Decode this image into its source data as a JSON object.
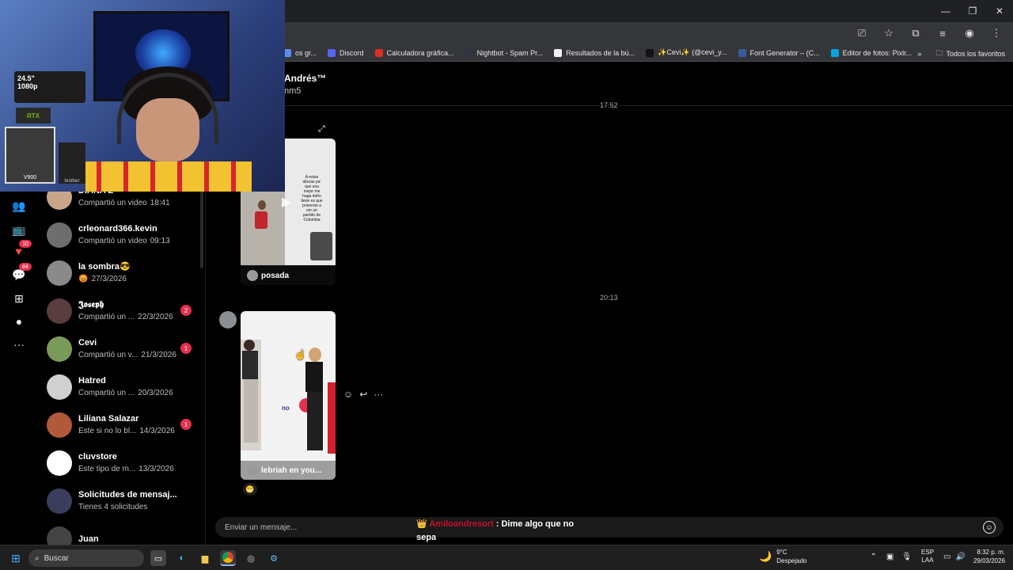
{
  "browser": {
    "controls": {
      "minimize": "—",
      "maximize": "❐",
      "close": "✕"
    },
    "address_icons": [
      "cast-icon",
      "star-icon",
      "extensions-icon",
      "media-icon",
      "profile-icon",
      "menu-icon"
    ],
    "bookmarks": [
      {
        "label": "os gr...",
        "color": "#5b8def"
      },
      {
        "label": "Discord",
        "color": "#5865f2"
      },
      {
        "label": "Calculadora gráfica...",
        "color": "#d93025"
      },
      {
        "label": "Nightbot - Spam Pr...",
        "color": "#2f3542"
      },
      {
        "label": "Resultados de la bú...",
        "color": "#f1f1f1"
      },
      {
        "label": "✨Cevi✨ (@cevi_y...",
        "color": "#111111"
      },
      {
        "label": "Font Generator – (C...",
        "color": "#3b5998"
      },
      {
        "label": "Editor de fotos: Pixlr...",
        "color": "#00a6e0"
      }
    ],
    "more_bookmarks": "»",
    "all_favorites": "Todos los favoritos"
  },
  "nav": {
    "icons": [
      {
        "name": "friends-icon",
        "glyph": "👥"
      },
      {
        "name": "live-icon",
        "glyph": "📺"
      },
      {
        "name": "activity-icon",
        "glyph": "🔻",
        "badge": "10"
      },
      {
        "name": "messages-icon",
        "glyph": "💬",
        "badge": "84"
      },
      {
        "name": "upload-icon",
        "glyph": "⊞"
      },
      {
        "name": "profile-avatar-icon",
        "glyph": "●"
      },
      {
        "name": "more-icon",
        "glyph": "···"
      }
    ]
  },
  "conversations": [
    {
      "name": "DIANA Z",
      "preview": "Compartió un video",
      "time": "18:41",
      "badge": "",
      "color": "#c9a58a"
    },
    {
      "name": "crleonard366.kevin",
      "preview": "Compartió un video",
      "time": "09:13",
      "badge": "",
      "color": "#6e6e6e"
    },
    {
      "name": "la sombra😎",
      "preview": "😡",
      "time": "27/3/2026",
      "badge": "",
      "color": "#8a8a8a"
    },
    {
      "name": "𝕵𝖔𝖘𝖊𝖕𝖍",
      "preview": "Compartió un ...",
      "time": "22/3/2026",
      "badge": "2",
      "color": "#5a3d3d"
    },
    {
      "name": "Cevi",
      "preview": "Compartió un v...",
      "time": "21/3/2026",
      "badge": "1",
      "color": "#7a9a5a"
    },
    {
      "name": "Hatred",
      "preview": "Compartió un ...",
      "time": "20/3/2026",
      "badge": "",
      "color": "#d0d0d0"
    },
    {
      "name": "Liliana Salazar",
      "preview": "Este si no lo bl...",
      "time": "14/3/2026",
      "badge": "1",
      "color": "#b05a3a"
    },
    {
      "name": "cluvstore",
      "preview": "Este tipo de m...",
      "time": "13/3/2026",
      "badge": "",
      "color": "#ffffff"
    },
    {
      "name": "Solicitudes de mensaj...",
      "preview": "Tienes 4 solicitudes",
      "time": "",
      "badge": "",
      "color": "#3a3d5c"
    },
    {
      "name": "Juan",
      "preview": "",
      "time": "",
      "badge": "",
      "color": "#444444"
    }
  ],
  "chat": {
    "name": "Andrés™",
    "username": "nm5",
    "timestamp_top": "17:52",
    "timestamp_mid": "20:13",
    "video1_caption_lines": [
      "A estas",
      "alturas pa'",
      "que una",
      "mejor me",
      "haga daño",
      "tiene es que",
      "ponerme a",
      "ver un",
      "partido de",
      "Colombia"
    ],
    "video1_author": "posada",
    "video2_label": "no",
    "video2_author": "lebriah en you...",
    "reaction": "😬",
    "actions": {
      "react": "☺",
      "reply": "↩",
      "more": "···"
    },
    "expand": "⤢"
  },
  "composer": {
    "placeholder": "Enviar un mensaje...",
    "emoji": "☺"
  },
  "stream_chat": {
    "badge": "👑",
    "user": "Amiloandresort",
    "message": ": Dime algo que no sepa"
  },
  "webcam": {
    "monitor_text_1": "24.5\"",
    "monitor_text_2": "1080p",
    "brand": "RTX",
    "model": "V900",
    "maker": "brother"
  },
  "taskbar": {
    "search_label": "Buscar",
    "apps": [
      "start-icon",
      "task-view-icon",
      "edge-icon",
      "explorer-icon",
      "chrome-icon",
      "obs-icon",
      "steam-icon"
    ],
    "weather_temp": "9°C",
    "weather_desc": "Despejado",
    "lang_1": "ESP",
    "lang_2": "LAA",
    "time": "8:32 p. m.",
    "date": "29/03/2026"
  }
}
